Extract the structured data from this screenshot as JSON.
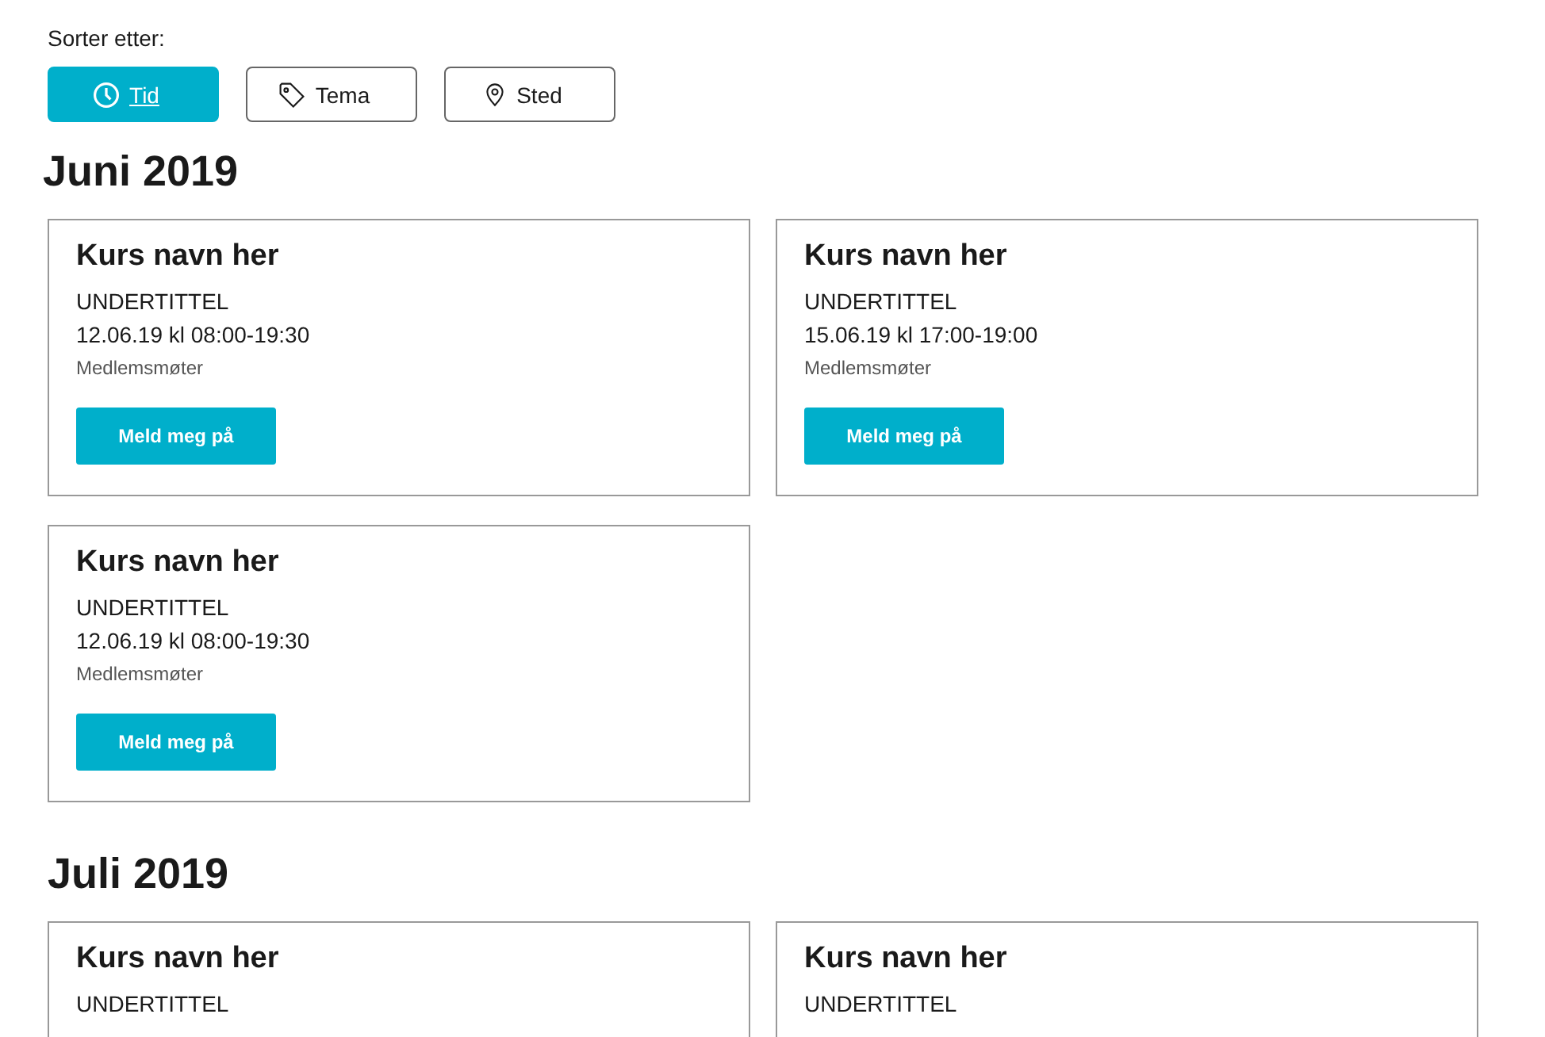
{
  "sort": {
    "label": "Sorter etter:",
    "options": [
      {
        "kind": "clock",
        "label": "Tid",
        "selected": true
      },
      {
        "kind": "tag",
        "label": "Tema",
        "selected": false
      },
      {
        "kind": "pin",
        "label": "Sted",
        "selected": false
      }
    ]
  },
  "months": [
    {
      "title": "Juni 2019",
      "events": [
        {
          "title": "Kurs navn her",
          "subtitle": "UNDERTITTEL",
          "time": "12.06.19 kl 08:00-19:30",
          "category": "Medlemsmøter",
          "button": "Meld meg på"
        },
        {
          "title": "Kurs navn her",
          "subtitle": "UNDERTITTEL",
          "time": "15.06.19 kl 17:00-19:00",
          "category": "Medlemsmøter",
          "button": "Meld meg på"
        },
        {
          "title": "Kurs navn her",
          "subtitle": "UNDERTITTEL",
          "time": "12.06.19 kl 08:00-19:30",
          "category": "Medlemsmøter",
          "button": "Meld meg på"
        }
      ]
    },
    {
      "title": "Juli 2019",
      "events": [
        {
          "title": "Kurs navn her",
          "subtitle": "UNDERTITTEL"
        },
        {
          "title": "Kurs navn her",
          "subtitle": "UNDERTITTEL"
        }
      ]
    }
  ]
}
